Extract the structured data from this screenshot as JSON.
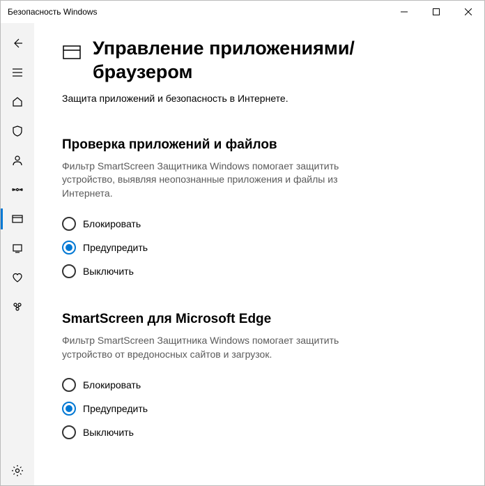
{
  "window": {
    "title": "Безопасность Windows"
  },
  "page": {
    "heading": "Управление приложениями/браузером",
    "subtitle": "Защита приложений и безопасность в Интернете."
  },
  "sections": {
    "apps": {
      "title": "Проверка приложений и файлов",
      "desc": "Фильтр SmartScreen Защитника Windows помогает защитить устройство, выявляя неопознанные приложения и файлы из Интернета.",
      "options": {
        "block": "Блокировать",
        "warn": "Предупредить",
        "off": "Выключить"
      },
      "selected": "warn"
    },
    "edge": {
      "title": "SmartScreen для Microsoft Edge",
      "desc": "Фильтр SmartScreen Защитника Windows помогает защитить устройство от вредоносных сайтов и загрузок.",
      "options": {
        "block": "Блокировать",
        "warn": "Предупредить",
        "off": "Выключить"
      },
      "selected": "warn"
    }
  }
}
